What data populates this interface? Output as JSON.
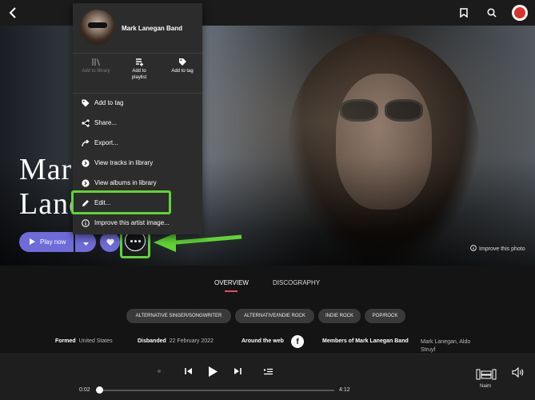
{
  "top_bar": {
    "back_icon": "chevron-left-icon",
    "bookmark_icon": "bookmark-icon",
    "search_icon": "search-icon",
    "profile_icon": "profile-avatar-icon"
  },
  "hero": {
    "artist_name_line1": "Mark",
    "artist_name_line2": "Lane",
    "improve_photo": "Improve this photo",
    "play_now": "Play now"
  },
  "context_menu": {
    "artist": "Mark Lanegan Band",
    "actions": [
      {
        "label_line1": "Add to library",
        "label_line2": "",
        "enabled": false
      },
      {
        "label_line1": "Add to",
        "label_line2": "playlist",
        "enabled": true
      },
      {
        "label_line1": "Add to tag",
        "label_line2": "",
        "enabled": true
      }
    ],
    "items": [
      {
        "label": "Add to tag",
        "icon": "tag-icon"
      },
      {
        "label": "Share...",
        "icon": "share-icon"
      },
      {
        "label": "Export...",
        "icon": "export-icon"
      },
      {
        "label": "View tracks in library",
        "icon": "arrow-right-circle-icon"
      },
      {
        "label": "View albums in library",
        "icon": "arrow-right-circle-icon"
      },
      {
        "label": "Edit...",
        "icon": "pencil-icon"
      },
      {
        "label": "Improve this artist image...",
        "icon": "info-icon"
      }
    ]
  },
  "tabs": {
    "overview": "OVERVIEW",
    "discography": "DISCOGRAPHY"
  },
  "tags": [
    "ALTERNATIVE SINGER/SONGWRITER",
    "ALTERNATIVE/INDIE ROCK",
    "INDIE ROCK",
    "POP/ROCK"
  ],
  "info": {
    "formed_label": "Formed",
    "formed_value": "United States",
    "disbanded_label": "Disbanded",
    "disbanded_value": "22 February 2022",
    "web_label": "Around the web",
    "members_label": "Members of Mark Lanegan Band",
    "members_value_line1": "Mark Lanegan, Aldo",
    "members_value_line2": "Struyf"
  },
  "player": {
    "elapsed": "0:02",
    "duration": "4:12",
    "device": "Naim",
    "progress_fraction": 0.008
  },
  "colors": {
    "accent": "#6f6cd9",
    "highlight": "#5fd434",
    "tab_underline": "#e0505a"
  }
}
